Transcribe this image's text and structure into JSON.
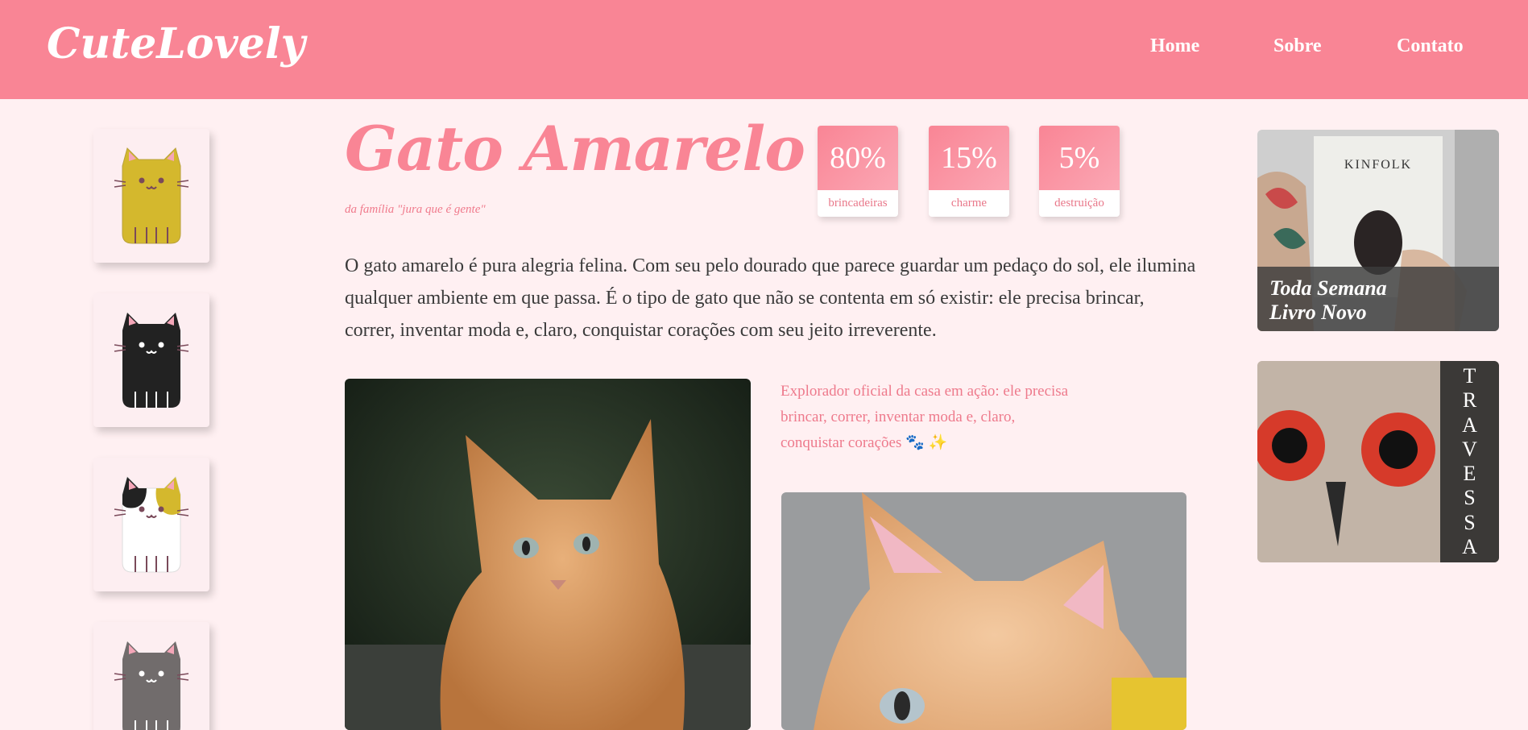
{
  "header": {
    "logo": "CuteLovely",
    "nav": [
      "Home",
      "Sobre",
      "Contato"
    ]
  },
  "sidebar": {
    "cats": [
      {
        "name": "yellow-cat-icon",
        "color": "#d4b82d"
      },
      {
        "name": "black-cat-icon",
        "color": "#222222"
      },
      {
        "name": "calico-cat-icon",
        "color": "#ffffff"
      },
      {
        "name": "gray-cat-icon",
        "color": "#716c6c"
      }
    ]
  },
  "main": {
    "title": "Gato Amarelo",
    "subtitle": "da família \"jura que é gente\"",
    "stats": [
      {
        "value": "80%",
        "label": "brincadeiras"
      },
      {
        "value": "15%",
        "label": "charme"
      },
      {
        "value": "5%",
        "label": "destruição"
      }
    ],
    "intro": "O gato amarelo é pura alegria felina. Com seu pelo dourado que parece guardar um pedaço do sol, ele ilumina qualquer ambiente em que passa. É o tipo de gato que não se contenta em só existir: ele precisa brincar, correr, inventar moda e, claro, conquistar corações com seu jeito irreverente.",
    "caption": "Explorador oficial da casa em ação: ele precisa brincar, correr, inventar moda e, claro, conquistar corações 🐾 ✨"
  },
  "ads": {
    "ad1": {
      "text_line1": "Toda Semana",
      "text_line2": "Livro Novo",
      "magazine": "KINFOLK"
    },
    "ad2": {
      "letters": [
        "T",
        "R",
        "A",
        "V",
        "E",
        "S",
        "S",
        "A"
      ]
    }
  },
  "colors": {
    "accent": "#f98595",
    "background": "#fff0f2"
  }
}
